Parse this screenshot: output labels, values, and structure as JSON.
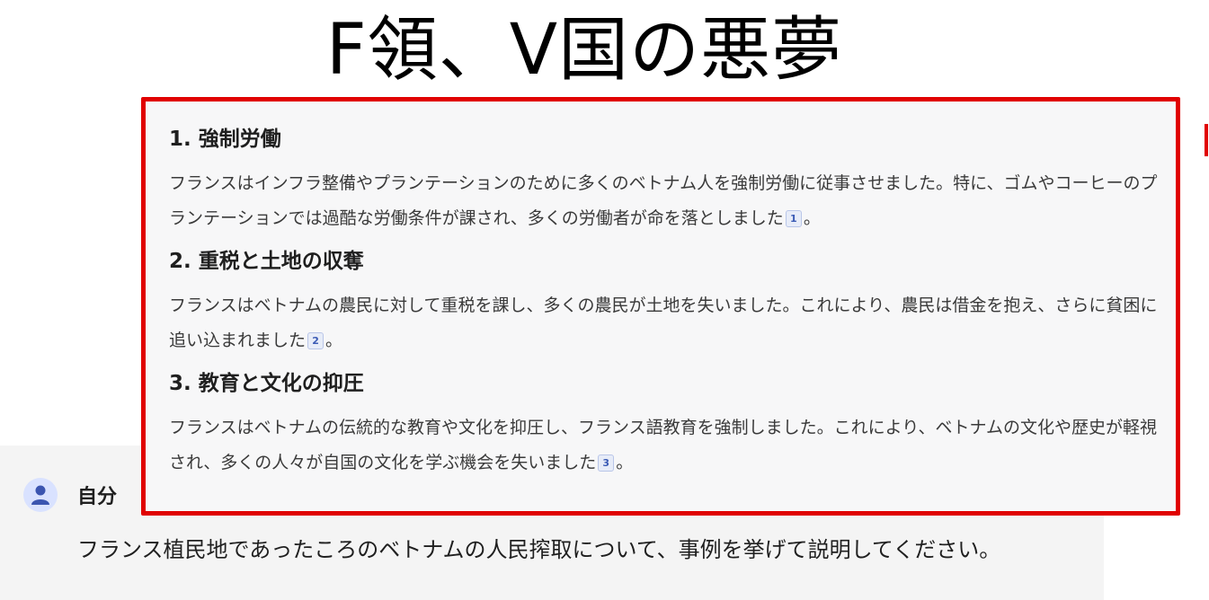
{
  "headline": "F領、V国の悪夢",
  "answer": {
    "sections": [
      {
        "title": "1. 強制労働",
        "body": "フランスはインフラ整備やプランテーションのために多くのベトナム人を強制労働に従事させました。特に、ゴムやコーヒーのプランテーションでは過酷な労働条件が課され、多くの労働者が命を落としました",
        "citation": "1",
        "end": "。"
      },
      {
        "title": "2. 重税と土地の収奪",
        "body": "フランスはベトナムの農民に対して重税を課し、多くの農民が土地を失いました。これにより、農民は借金を抱え、さらに貧困に追い込まれました",
        "citation": "2",
        "end": "。"
      },
      {
        "title": "3. 教育と文化の抑圧",
        "body": "フランスはベトナムの伝統的な教育や文化を抑圧し、フランス語教育を強制しました。これにより、ベトナムの文化や歴史が軽視され、多くの人々が自国の文化を学ぶ機会を失いました",
        "citation": "3",
        "end": "。"
      }
    ]
  },
  "user": {
    "name": "自分",
    "avatar_icon": "person-icon",
    "message": "フランス植民地であったころのベトナムの人民搾取について、事例を挙げて説明してください。"
  },
  "colors": {
    "highlight_border": "#e00000",
    "panel_bg": "#f4f4f4",
    "avatar_bg": "#d9e2ff",
    "avatar_fg": "#3b55b0"
  }
}
